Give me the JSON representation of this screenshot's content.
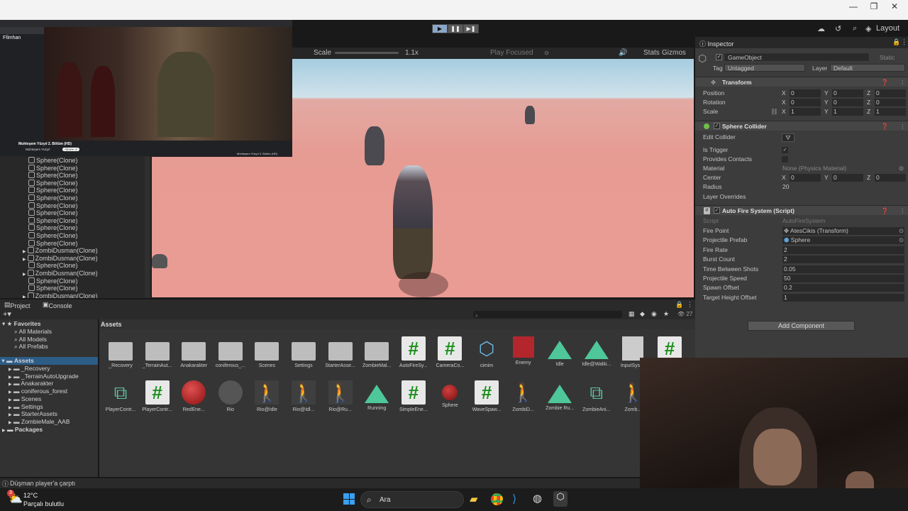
{
  "scene_toolbar": {
    "scale_label": "Scale",
    "scale_value": "1.1x",
    "play_focused": "Play Focused",
    "stats": "Stats",
    "gizmos": "Gizmos"
  },
  "top_right": {
    "layout": "Layout"
  },
  "hierarchy": {
    "items": [
      "Sphere(Clone)",
      "Sphere(Clone)",
      "Sphere(Clone)",
      "Sphere(Clone)",
      "Sphere(Clone)",
      "Sphere(Clone)",
      "Sphere(Clone)",
      "Sphere(Clone)",
      "Sphere(Clone)",
      "Sphere(Clone)",
      "Sphere(Clone)",
      "Sphere(Clone)",
      "ZombiDusman(Clone)",
      "ZombiDusman(Clone)",
      "Sphere(Clone)",
      "ZombiDusman(Clone)",
      "Sphere(Clone)",
      "Sphere(Clone)",
      "ZombiDusman(Clone)"
    ]
  },
  "browser": {
    "site_name": "Fİlmhan",
    "video_title": "Muhteşem Yüzyıl 2. Bölüm (HD)",
    "channel": "Muhteşem Yüzyıl",
    "subscribe": "Abone ol",
    "sidebar_title": "Muhteşem Yüzyıl 3. Bölüm (HD)"
  },
  "inspector": {
    "tab": "Inspector",
    "object_name": "GameObject",
    "static": "Static",
    "tag_label": "Tag",
    "tag_value": "Untagged",
    "layer_label": "Layer",
    "layer_value": "Default",
    "transform": {
      "title": "Transform",
      "position": "Position",
      "rotation": "Rotation",
      "scale": "Scale",
      "pos": [
        "0",
        "0",
        "0"
      ],
      "rot": [
        "0",
        "0",
        "0"
      ],
      "scl": [
        "1",
        "1",
        "1"
      ]
    },
    "collider": {
      "title": "Sphere Collider",
      "edit": "Edit Collider",
      "is_trigger": "Is Trigger",
      "provides_contacts": "Provides Contacts",
      "material": "Material",
      "material_value": "None (Physics Material)",
      "center": "Center",
      "center_vals": [
        "0",
        "0",
        "0"
      ],
      "radius": "Radius",
      "radius_value": "20",
      "layer_overrides": "Layer Overrides"
    },
    "autofire": {
      "title": "Auto Fire System (Script)",
      "script_label": "Script",
      "script_value": "AutoFireSystem",
      "fields": [
        {
          "label": "Fire Point",
          "value": "AtesCikis (Transform)"
        },
        {
          "label": "Projectile Prefab",
          "value": "Sphere"
        },
        {
          "label": "Fire Rate",
          "value": "2"
        },
        {
          "label": "Burst Count",
          "value": "2"
        },
        {
          "label": "Time Between Shots",
          "value": "0.05"
        },
        {
          "label": "Projectile Speed",
          "value": "50"
        },
        {
          "label": "Spawn Offset",
          "value": "0.2"
        },
        {
          "label": "Target Height Offset",
          "value": "1"
        }
      ]
    },
    "add_component": "Add Component"
  },
  "project": {
    "tabs": [
      "Project",
      "Console"
    ],
    "count": "27",
    "assets_header": "Assets",
    "favorites": "Favorites",
    "fav_items": [
      "All Materials",
      "All Models",
      "All Prefabs"
    ],
    "assets_root": "Assets",
    "folders": [
      "_Recovery",
      "_TerrainAutoUpgrade",
      "Anakarakter",
      "coniferous_forest",
      "Scenes",
      "Settings",
      "StarterAssets",
      "ZombieMale_AAB"
    ],
    "packages": "Packages",
    "row1": [
      "_Recovery",
      "_TerrainAut...",
      "Anakarakter",
      "coniferous_...",
      "Scenes",
      "Settings",
      "StarterAsse...",
      "ZombieMal...",
      "AutoFireSy...",
      "CameraCo...",
      "cimim",
      "Enemy",
      "Idle",
      "Idle@Walki...",
      "InputSyst...",
      ""
    ],
    "row2": [
      "PlayerContr...",
      "PlayerContr...",
      "RedEne...",
      "Rio",
      "Rio@Idle",
      "Rio@Idl...",
      "Rio@Ru...",
      "Running",
      "SimpleEne...",
      "Sphere",
      "WaveSpaw...",
      "ZombiD...",
      "Zombie Ru...",
      "ZombieAni...",
      "Zomb..."
    ]
  },
  "status": "Düşman player'a çarptı",
  "taskbar": {
    "temp": "12°C",
    "weather": "Parçalı bulutlu",
    "search": "Ara",
    "badge": "3"
  }
}
